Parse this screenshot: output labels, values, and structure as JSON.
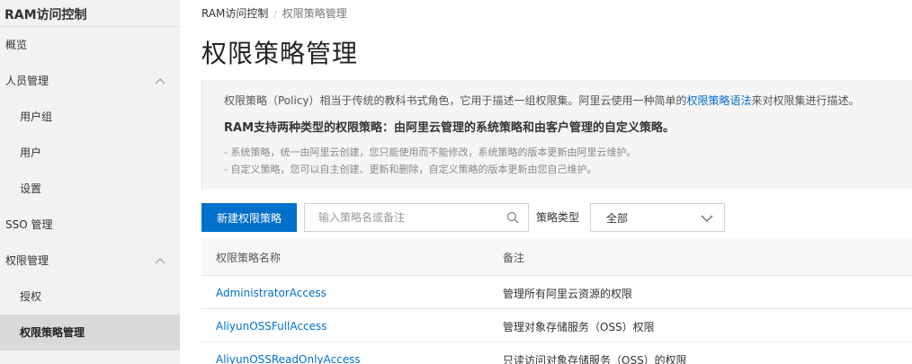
{
  "sidebar": {
    "title": "RAM访问控制",
    "items": [
      {
        "label": "概览"
      },
      {
        "label": "人员管理"
      },
      {
        "label": "用户组"
      },
      {
        "label": "用户"
      },
      {
        "label": "设置"
      },
      {
        "label": "SSO 管理"
      },
      {
        "label": "权限管理"
      },
      {
        "label": "授权"
      },
      {
        "label": "权限策略管理"
      }
    ],
    "active_item": "权限策略管理"
  },
  "breadcrumb": {
    "root": "RAM访问控制",
    "separator": "/",
    "current": "权限策略管理"
  },
  "page_title": "权限策略管理",
  "info": {
    "line1_pre": "权限策略（Policy）相当于传统的教科书式角色，它用于描述一组权限集。阿里云使用一种简单的",
    "line1_link": "权限策略语法",
    "line1_post": "来对权限集进行描述。",
    "line2": "RAM支持两种类型的权限策略：由阿里云管理的系统策略和由客户管理的自定义策略。",
    "note1": "- 系统策略，统一由阿里云创建，您只能使用而不能修改，系统策略的版本更新由阿里云维护。",
    "note2": "- 自定义策略，您可以自主创建、更新和删除，自定义策略的版本更新由您自己维护。"
  },
  "toolbar": {
    "new_button": "新建权限策略",
    "search_placeholder": "输入策略名或备注",
    "search_value": "",
    "type_label": "策略类型",
    "type_selected": "全部"
  },
  "table": {
    "headers": [
      "权限策略名称",
      "备注"
    ],
    "rows": [
      {
        "name": "AdministratorAccess",
        "note": "管理所有阿里云资源的权限"
      },
      {
        "name": "AliyunOSSFullAccess",
        "note": "管理对象存储服务（OSS）权限"
      },
      {
        "name": "AliyunOSSReadOnlyAccess",
        "note": "只读访问对象存储服务（OSS）的权限"
      }
    ]
  },
  "colors": {
    "primary": "#0070cc",
    "sidebar_bg": "#f2f2f2",
    "active_bg": "#d9d9d9",
    "info_bg": "#f5f5f5"
  },
  "icons": {
    "expand": "chevron-up-icon",
    "search": "search-icon",
    "dropdown": "chevron-down-icon"
  }
}
